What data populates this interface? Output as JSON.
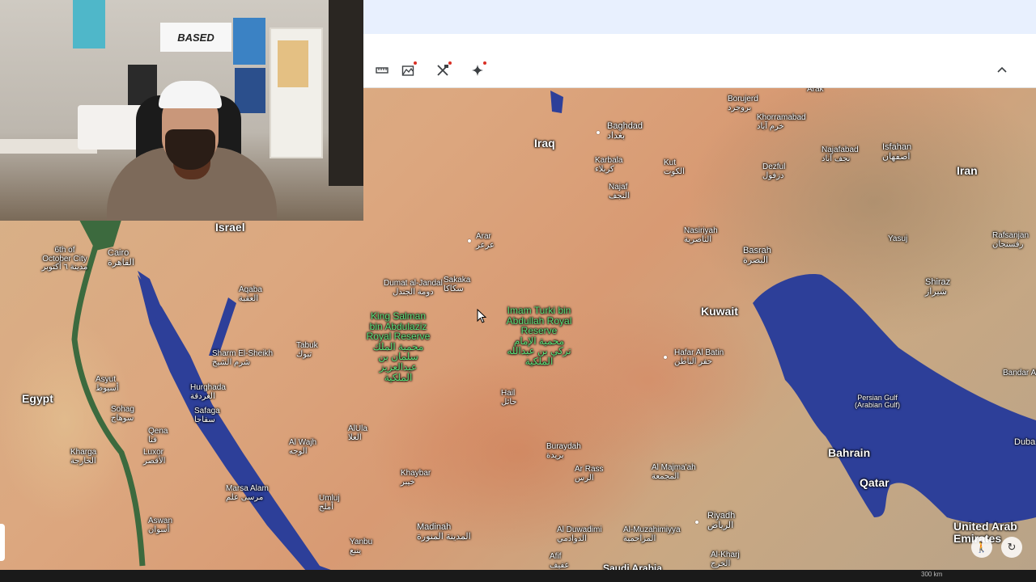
{
  "webcam": {
    "sign_text": "BASED"
  },
  "toolbar": {
    "measure_label": "Measure",
    "elevation_label": "Elevation",
    "tools_label": "Tools",
    "ai_label": "AI",
    "collapse_label": "^"
  },
  "map": {
    "countries": {
      "iraq": "Iraq",
      "iran": "Iran",
      "kuwait": "Kuwait",
      "egypt": "Egypt",
      "israel": "Israel",
      "bahrain": "Bahrain",
      "qatar": "Qatar",
      "uae": "United Arab Emirates"
    },
    "cities": {
      "borujerd": "Borujerd",
      "borujerd_ar": "بروجرد",
      "arak": "Arak",
      "baghdad": "Baghdad",
      "baghdad_ar": "بغداد",
      "khorramabad": "Khorramabad",
      "khorramabad_ar": "خرم آباد",
      "najafabad": "Najafabad",
      "najafabad_ar": "نجف آباد",
      "isfahan": "Isfahan",
      "isfahan_ar": "اصفهان",
      "karbala": "Karbala",
      "karbala_ar": "كربلاء",
      "kut": "Kut",
      "kut_ar": "الكوت",
      "dezful": "Dezful",
      "dezful_ar": "دزفول",
      "najaf": "Najaf",
      "najaf_ar": "النجف",
      "arar": "Arar",
      "arar_ar": "عرعر",
      "nasiriyah": "Nasiriyah",
      "nasiriyah_ar": "الناصرية",
      "basrah": "Basrah",
      "basrah_ar": "البصرة",
      "yasuj": "Yasuj",
      "rafsanjan": "Rafsanjan",
      "rafsanjan_ar": "رفسنجان",
      "shiraz": "Shiraz",
      "shiraz_ar": "شیراز",
      "dumat": "Dumat al-Jandal",
      "dumat_ar": "دومة الجندل",
      "sakaka": "Sakaka",
      "sakaka_ar": "سكاكا",
      "sixth_october": "6th of October City",
      "sixth_october_ar": "مدينة ٦ أكتوبر",
      "cairo": "Cairo",
      "cairo_ar": "القاهرة",
      "aqaba": "Aqaba",
      "aqaba_ar": "العقبة",
      "tabuk": "Tabuk",
      "tabuk_ar": "تبوك",
      "hafar": "Hafar Al Batin",
      "hafar_ar": "حفر الباطن",
      "bandar_abbas": "Bandar Ab",
      "sharm": "Sharm El-Sheikh",
      "sharm_ar": "شرم الشيخ",
      "asyut": "Asyut",
      "asyut_ar": "أسيوط",
      "hurghada": "Hurghada",
      "hurghada_ar": "الغردقة",
      "hail": "Hail",
      "hail_ar": "حائل",
      "sohag": "Sohag",
      "sohag_ar": "سوهاج",
      "safaga": "Safaga",
      "safaga_ar": "سفاجا",
      "alula": "AlUla",
      "alula_ar": "العلا",
      "qena": "Qena",
      "qena_ar": "قنا",
      "al_wajh": "Al Wajh",
      "al_wajh_ar": "الوجه",
      "buraydah": "Buraydah",
      "buraydah_ar": "بريدة",
      "kharga": "Kharga",
      "kharga_ar": "الخارجة",
      "luxor": "Luxor",
      "luxor_ar": "الأقصر",
      "dubai": "Duba",
      "ar_rass": "Ar Rass",
      "ar_rass_ar": "الرس",
      "al_majmaah": "Al Majma'ah",
      "al_majmaah_ar": "المجمعة",
      "khaybar": "Khaybar",
      "khaybar_ar": "خيبر",
      "marsa_alam": "Marsa Alam",
      "marsa_alam_ar": "مرسى علم",
      "umluj": "Umluj",
      "umluj_ar": "أملج",
      "riyadh": "Riyadh",
      "riyadh_ar": "الرياض",
      "aswan": "Aswan",
      "aswan_ar": "أسوان",
      "madinah": "Madinah",
      "madinah_ar": "المدينة المنورة",
      "al_duwadimi": "Al Duwadimi",
      "al_duwadimi_ar": "الدوادمي",
      "al_muzahimiyya": "Al-Muzahimiyya",
      "al_muzahimiyya_ar": "المزاحمية",
      "yanbu": "Yanbu",
      "yanbu_ar": "ينبع",
      "afif": "Afif",
      "afif_ar": "عفيف",
      "al_kharj": "Al-Kharj",
      "al_kharj_ar": "الخرج",
      "saudi_arabia": "Saudi Arabia"
    },
    "reserves": {
      "king_salman": "King Salman bin Abdulaziz Royal Reserve",
      "king_salman_ar": "محمية الملك سلمان بن عبدالعزيز الملكية",
      "imam_turki": "Imam Turki bin Abdullah Royal Reserve",
      "imam_turki_ar": "محمية الإمام تركي بن عبدالله الملكية"
    },
    "seas": {
      "persian_gulf": "Persian Gulf (Arabian Gulf)"
    },
    "scale_text": "300 km"
  },
  "colors": {
    "water": "#2d3f99",
    "desert": "#d9a57d",
    "reserve_text": "#5fe07a",
    "toolbar_bg": "#ffffff",
    "topbar_bg": "#e8f0fe"
  },
  "icons": [
    "ruler-icon",
    "elevation-icon",
    "tools-icon",
    "sparkle-icon",
    "chevron-up-icon",
    "pegman-icon",
    "compass-reset-icon",
    "cursor-icon"
  ]
}
